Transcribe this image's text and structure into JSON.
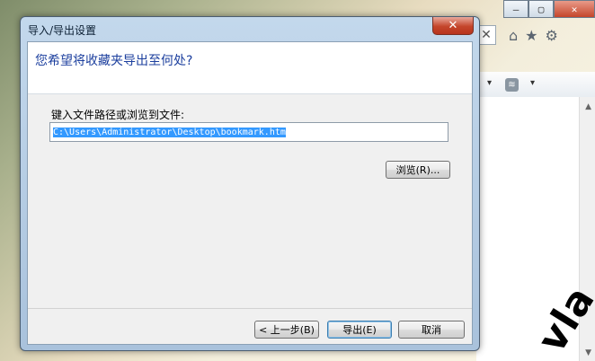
{
  "dialog": {
    "title": "导入/导出设置",
    "close_glyph": "✕",
    "header": "您希望将收藏夹导出至何处?",
    "path_label": "键入文件路径或浏览到文件:",
    "path_value": "C:\\Users\\Administrator\\Desktop\\bookmark.htm",
    "browse_label": "浏览(R)...",
    "back_label": "< 上一步(B)",
    "export_label": "导出(E)",
    "cancel_label": "取消"
  },
  "browser": {
    "minimize_glyph": "—",
    "maximize_glyph": "▢",
    "close_glyph": "✕",
    "address_close_glyph": "✕",
    "icons": [
      "home-icon",
      "star-icon",
      "gear-icon"
    ],
    "home_glyph": "⌂",
    "star_glyph": "★",
    "gear_glyph": "⚙",
    "rss_glyph": "≋",
    "dropdown_glyph": "▾",
    "scroll_up_glyph": "▲",
    "scroll_down_glyph": "▼"
  },
  "watermark": "vla"
}
